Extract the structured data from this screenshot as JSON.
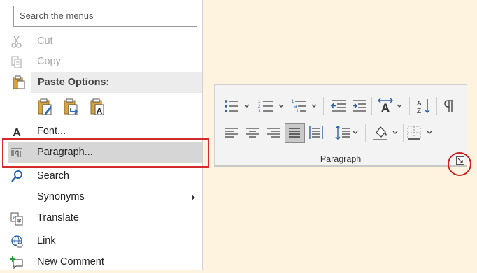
{
  "search": {
    "placeholder": "Search the menus"
  },
  "menu": {
    "cut": "Cut",
    "copy": "Copy",
    "paste_options": "Paste Options:",
    "font": "Font...",
    "paragraph": "Paragraph...",
    "search": "Search",
    "synonyms": "Synonyms",
    "translate": "Translate",
    "link": "Link",
    "new_comment": "New Comment"
  },
  "paste_icons": [
    "keep-source-formatting-icon",
    "merge-formatting-icon",
    "keep-text-only-icon"
  ],
  "ribbon": {
    "group_label": "Paragraph",
    "row1": [
      "bullets",
      "numbering",
      "multilevel-list",
      "decrease-indent",
      "increase-indent",
      "text-direction",
      "sort",
      "show-hide-marks"
    ],
    "row2": [
      "align-left",
      "center",
      "align-right",
      "justify",
      "distributed",
      "line-spacing",
      "shading",
      "borders"
    ],
    "selected": "justify"
  },
  "colors": {
    "highlight_border": "#d42a2a",
    "background": "#fdf3df",
    "menu_hover": "#d6d6d6"
  }
}
